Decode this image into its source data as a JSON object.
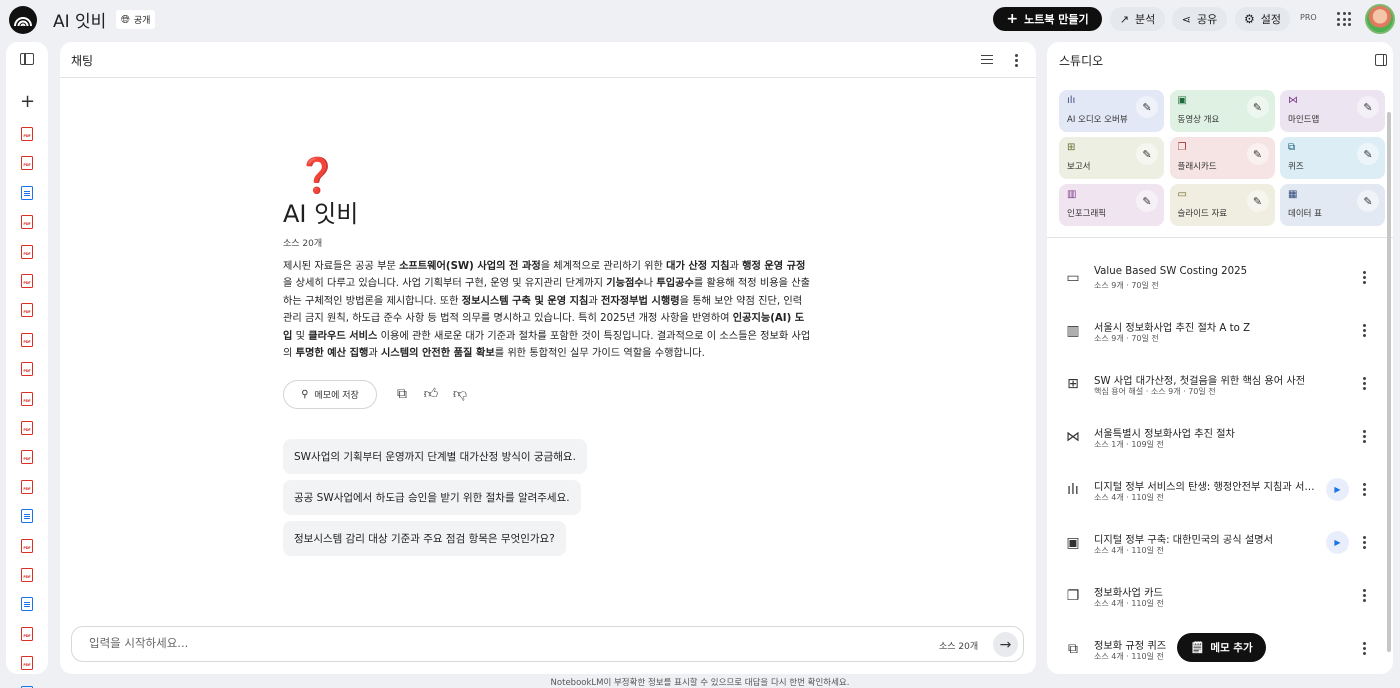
{
  "app": {
    "notebook_title": "AI 잇비",
    "share_pill": "공개",
    "create_button": "노트북 만들기",
    "analytics_button": "분석",
    "share_button": "공유",
    "settings_button": "설정",
    "pro_badge": "PRO"
  },
  "sources": {
    "icons": [
      "pdf",
      "pdf",
      "doc",
      "pdf",
      "pdf",
      "pdf",
      "pdf",
      "pdf",
      "pdf",
      "pdf",
      "pdf",
      "pdf",
      "pdf",
      "doc",
      "pdf",
      "pdf",
      "doc",
      "pdf",
      "pdf",
      "doc"
    ],
    "pdf_tag": "PDF"
  },
  "chat": {
    "header": "채팅",
    "emoji": "❓",
    "title": "AI 잇비",
    "source_count": "소스 20개",
    "summary_parts": [
      {
        "t": "제시된 자료들은 공공 부문 ",
        "b": false
      },
      {
        "t": "소프트웨어(SW) 사업의 전 과정",
        "b": true
      },
      {
        "t": "을 체계적으로 관리하기 위한 ",
        "b": false
      },
      {
        "t": "대가 산정 지침",
        "b": true
      },
      {
        "t": "과 ",
        "b": false
      },
      {
        "t": "행정 운영 규정",
        "b": true
      },
      {
        "t": "을 상세히 다루고 있습니다. 사업 기획부터 구현, 운영 및 유지관리 단계까지 ",
        "b": false
      },
      {
        "t": "기능점수",
        "b": true
      },
      {
        "t": "나 ",
        "b": false
      },
      {
        "t": "투입공수",
        "b": true
      },
      {
        "t": "를 활용해 적정 비용을 산출하는 구체적인 방법론을 제시합니다. 또한 ",
        "b": false
      },
      {
        "t": "정보시스템 구축 및 운영 지침",
        "b": true
      },
      {
        "t": "과 ",
        "b": false
      },
      {
        "t": "전자정부법 시행령",
        "b": true
      },
      {
        "t": "을 통해 보안 약점 진단, 인력 관리 금지 원칙, 하도급 준수 사항 등 법적 의무를 명시하고 있습니다. 특히 2025년 개정 사항을 반영하여 ",
        "b": false
      },
      {
        "t": "인공지능(AI) 도입",
        "b": true
      },
      {
        "t": " 및 ",
        "b": false
      },
      {
        "t": "클라우드 서비스",
        "b": true
      },
      {
        "t": " 이용에 관한 새로운 대가 기준과 절차를 포함한 것이 특징입니다. 결과적으로 이 소스들은 정보화 사업의 ",
        "b": false
      },
      {
        "t": "투명한 예산 집행",
        "b": true
      },
      {
        "t": "과 ",
        "b": false
      },
      {
        "t": "시스템의 안전한 품질 확보",
        "b": true
      },
      {
        "t": "를 위한 통합적인 실무 가이드 역할을 수행합니다.",
        "b": false
      }
    ],
    "save_memo": "메모에 저장",
    "suggestions": [
      "SW사업의 기획부터 운영까지 단계별 대가산정 방식이 궁금해요.",
      "공공 SW사업에서 하도급 승인을 받기 위한 절차를 알려주세요.",
      "정보시스템 감리 대상 기준과 주요 점검 항목은 무엇인가요?"
    ],
    "input_placeholder": "입력을 시작하세요...",
    "input_value": "",
    "input_source_count": "소스 20개"
  },
  "disclaimer": "NotebookLM이 부정확한 정보를 표시할 수 있으므로 대답을 다시 한번 확인하세요.",
  "studio": {
    "header": "스튜디오",
    "tiles": [
      {
        "label": "AI 오디오 오버뷰",
        "icon": "audio-icon",
        "bg": "#e3e8f6",
        "fg": "#3c4b7c"
      },
      {
        "label": "동영상 개요",
        "icon": "video-icon",
        "bg": "#dff1e3",
        "fg": "#1e6b37"
      },
      {
        "label": "마인드맵",
        "icon": "mindmap-icon",
        "bg": "#ece4f0",
        "fg": "#7a3b8c"
      },
      {
        "label": "보고서",
        "icon": "report-icon",
        "bg": "#ecefe2",
        "fg": "#5b6b2a"
      },
      {
        "label": "플래시카드",
        "icon": "flashcard-icon",
        "bg": "#f6e4e4",
        "fg": "#a33636"
      },
      {
        "label": "퀴즈",
        "icon": "quiz-icon",
        "bg": "#dcedf5",
        "fg": "#1a5f80"
      },
      {
        "label": "인포그래픽",
        "icon": "infographic-icon",
        "bg": "#efe4f0",
        "fg": "#7c3a86"
      },
      {
        "label": "슬라이드 자료",
        "icon": "slides-icon",
        "bg": "#efeee0",
        "fg": "#6b6320"
      },
      {
        "label": "데이터 표",
        "icon": "table-icon",
        "bg": "#e3e9f3",
        "fg": "#2f4a7a"
      }
    ],
    "notes": [
      {
        "title": "Value Based SW Costing 2025",
        "sub": "소스 9개 · 70일 전",
        "icon": "slides-icon",
        "glyph": "▭",
        "play": false
      },
      {
        "title": "서울시 정보화사업 추진 절차 A to Z",
        "sub": "소스 9개 · 70일 전",
        "icon": "infographic-icon",
        "glyph": "▥",
        "play": false
      },
      {
        "title": "SW 사업 대가산정, 첫걸음을 위한 핵심 용어 사전",
        "sub": "핵심 용어 해설 · 소스 9개 · 70일 전",
        "icon": "report-icon",
        "glyph": "⊞",
        "play": false
      },
      {
        "title": "서울특별시 정보화사업 추진 절차",
        "sub": "소스 1개 · 109일 전",
        "icon": "mindmap-icon",
        "glyph": "⋈",
        "play": false
      },
      {
        "title": "디지털 정부 서비스의 탄생: 행정안전부 지침과 서울시 추진 절차",
        "sub": "소스 4개 · 110일 전",
        "icon": "audio-icon",
        "glyph": "ılı",
        "play": true
      },
      {
        "title": "디지털 정부 구축: 대한민국의 공식 설명서",
        "sub": "소스 4개 · 110일 전",
        "icon": "video-icon",
        "glyph": "▣",
        "play": true
      },
      {
        "title": "정보화사업 카드",
        "sub": "소스 4개 · 110일 전",
        "icon": "flashcard-icon",
        "glyph": "❐",
        "play": false
      },
      {
        "title": "정보화 규정 퀴즈",
        "sub": "소스 4개 · 110일 전",
        "icon": "quiz-icon",
        "glyph": "⧉",
        "play": false
      }
    ],
    "add_memo": "메모 추가"
  }
}
